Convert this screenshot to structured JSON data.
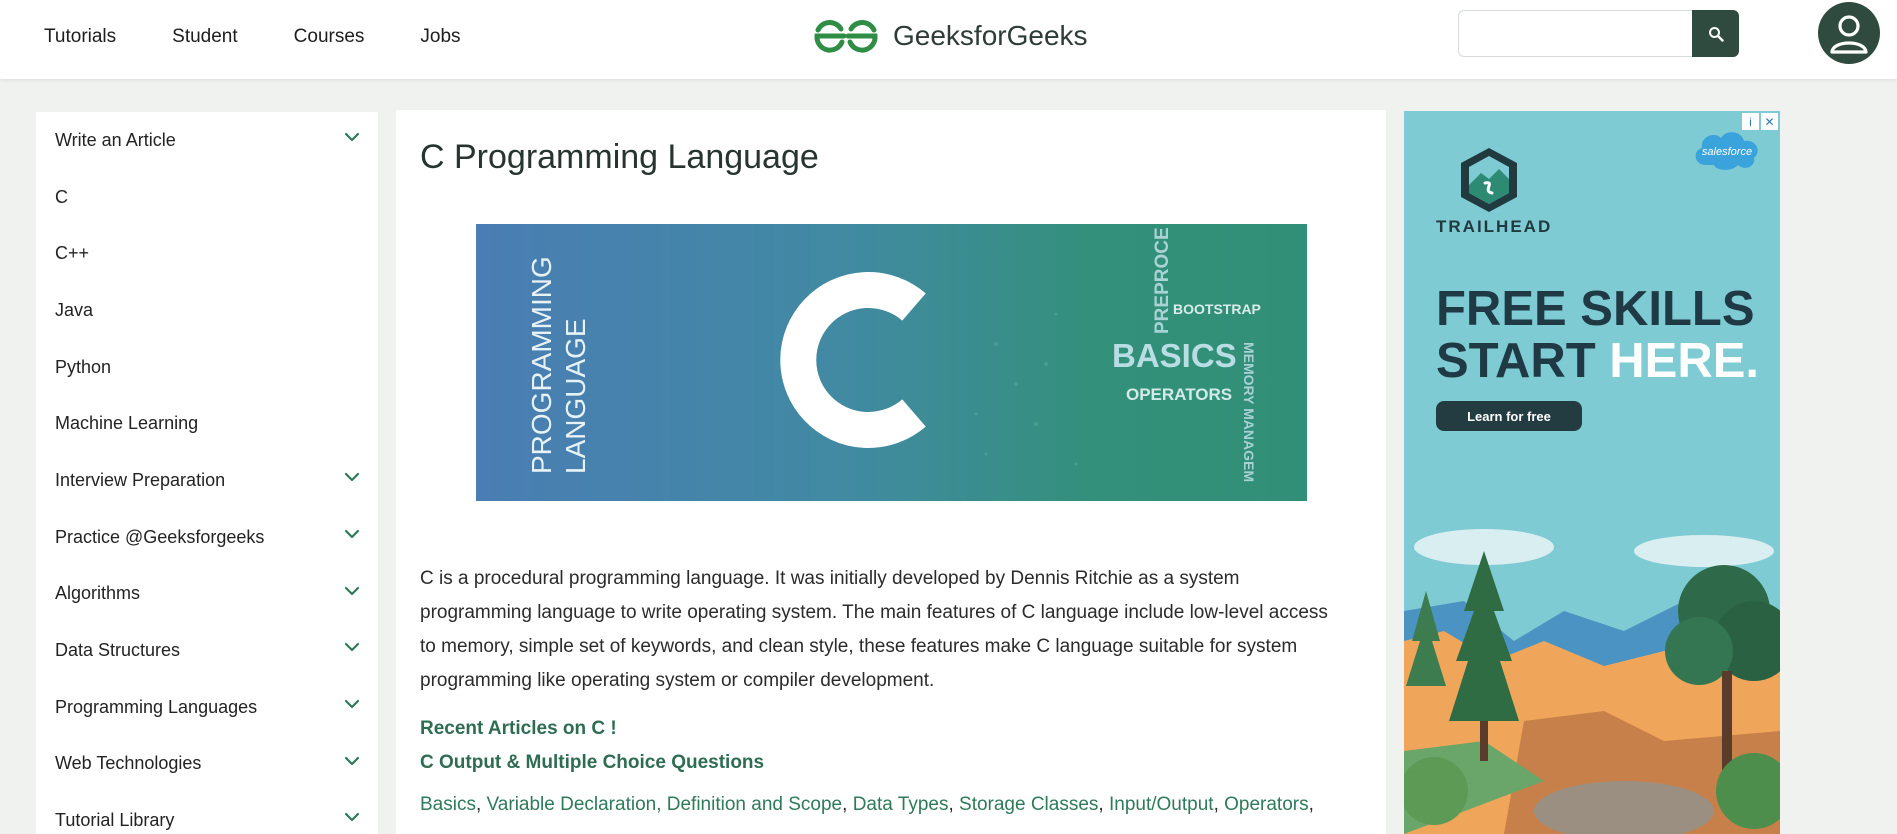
{
  "header": {
    "nav": [
      "Tutorials",
      "Student",
      "Courses",
      "Jobs"
    ],
    "brand": "GeeksforGeeks",
    "search_placeholder": ""
  },
  "sidebar": {
    "items": [
      {
        "label": "Write an Article",
        "expandable": true
      },
      {
        "label": "C",
        "expandable": false
      },
      {
        "label": "C++",
        "expandable": false
      },
      {
        "label": "Java",
        "expandable": false
      },
      {
        "label": "Python",
        "expandable": false
      },
      {
        "label": "Machine Learning",
        "expandable": false
      },
      {
        "label": "Interview Preparation",
        "expandable": true
      },
      {
        "label": "Practice @Geeksforgeeks",
        "expandable": true
      },
      {
        "label": "Algorithms",
        "expandable": true
      },
      {
        "label": "Data Structures",
        "expandable": true
      },
      {
        "label": "Programming Languages",
        "expandable": true
      },
      {
        "label": "Web Technologies",
        "expandable": true
      },
      {
        "label": "Tutorial Library",
        "expandable": true
      }
    ]
  },
  "article": {
    "title": "C Programming Language",
    "banner": {
      "side_text_1": "PROGRAMMING",
      "side_text_2": "LANGUAGE",
      "letter": "C",
      "words": {
        "preprocessor": "PREPROCE",
        "bootstrap": "BOOTSTRAP",
        "basics": "BASICS",
        "operators": "OPERATORS",
        "memory": "MEMORY MANAGEM"
      }
    },
    "intro_lines": [
      "C is a procedural programming language. It was initially developed by Dennis Ritchie as a system",
      "programming language to write operating system. The main features of C language include low-level access",
      "to memory, simple set of keywords, and clean style, these features make C language suitable for system",
      "programming like operating system or compiler development."
    ],
    "recent_link": "Recent Articles on C !",
    "mcq_link": "C Output & Multiple Choice Questions",
    "topics": [
      "Basics",
      "Variable Declaration, Definition and Scope",
      "Data Types",
      "Storage Classes",
      "Input/Output",
      "Operators"
    ]
  },
  "ad": {
    "info_icon": "i",
    "close_icon": "✕",
    "brand": "TRAILHEAD",
    "badge": "salesforce",
    "headline_line1": "FREE SKILLS",
    "headline_line2_dark": "START ",
    "headline_line2_light": "HERE.",
    "cta": "Learn for free"
  },
  "colors": {
    "brand_green": "#2f8d46",
    "nav_dark": "#2f4b3f",
    "link_green": "#2f7a59",
    "ad_teal": "#7ecbd3"
  }
}
